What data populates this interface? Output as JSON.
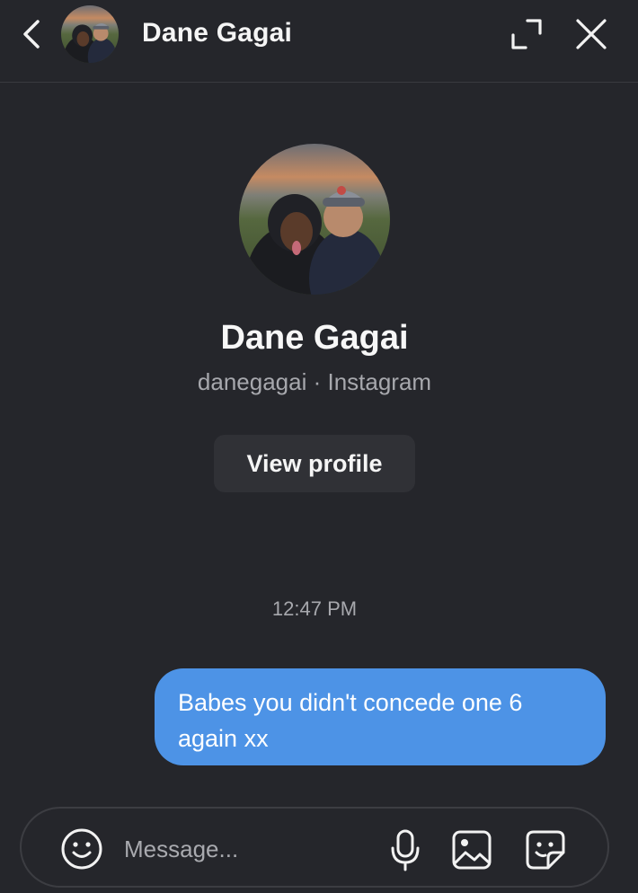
{
  "header": {
    "contact_name": "Dane Gagai",
    "back_icon": "chevron-left-icon",
    "expand_icon": "expand-icon",
    "close_icon": "close-icon"
  },
  "profile": {
    "name": "Dane Gagai",
    "username": "danegagai",
    "separator": "·",
    "platform": "Instagram",
    "subtitle": "danegagai · Instagram",
    "view_profile_label": "View profile"
  },
  "conversation": {
    "timestamp": "12:47 PM",
    "messages": [
      {
        "direction": "outgoing",
        "text": "Babes you didn't concede one 6 again xx"
      }
    ]
  },
  "composer": {
    "placeholder": "Message...",
    "value": "",
    "icons": [
      "emoji-icon",
      "microphone-icon",
      "image-icon",
      "sticker-icon"
    ]
  },
  "colors": {
    "background": "#25262b",
    "bubble": "#4d93e6",
    "button": "#303136",
    "muted_text": "#a7a8ad",
    "border": "#3c3d42"
  }
}
